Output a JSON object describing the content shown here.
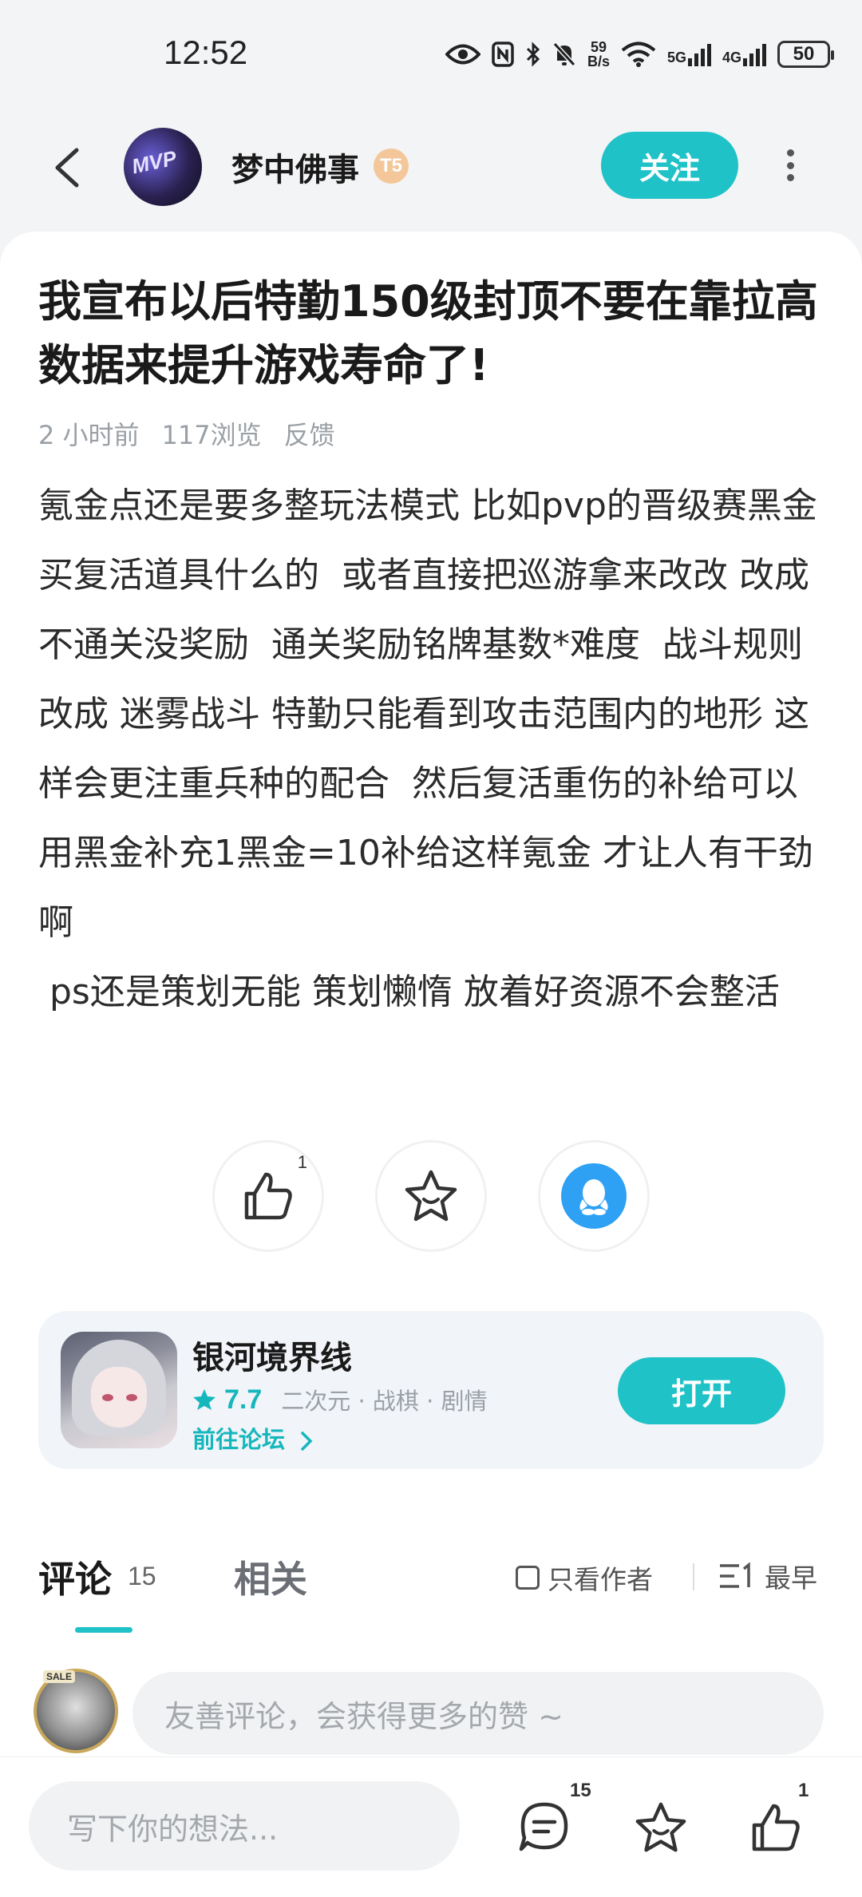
{
  "status_bar": {
    "time": "12:52",
    "net_speed_value": "59",
    "net_speed_unit": "B/s",
    "net_5g": "5G",
    "net_4g": "4G",
    "battery": "50"
  },
  "header": {
    "avatar_text": "MVP",
    "username": "梦中佛事",
    "badge": "T5",
    "follow_label": "关注"
  },
  "post": {
    "title": "我宣布以后特勤150级封顶不要在靠拉高数据来提升游戏寿命了!",
    "time_ago": "2 小时前",
    "views": "117浏览",
    "feedback": "反馈",
    "body": "氪金点还是要多整玩法模式 比如pvp的晋级赛黑金买复活道具什么的  或者直接把巡游拿来改改 改成不通关没奖励  通关奖励铭牌基数*难度  战斗规则改成 迷雾战斗 特勤只能看到攻击范围内的地形 这样会更注重兵种的配合  然后复活重伤的补给可以用黑金补充1黑金=10补给这样氪金 才让人有干劲啊\n ps还是策划无能 策划懒惰 放着好资源不会整活"
  },
  "actions": {
    "like_count": "1"
  },
  "app_card": {
    "name": "银河境界线",
    "rating": "7.7",
    "tags": "二次元 · 战棋 · 剧情",
    "forum_link": "前往论坛",
    "open_label": "打开"
  },
  "tabs": {
    "comment_label": "评论",
    "comment_count": "15",
    "related_label": "相关",
    "only_author": "只看作者",
    "sort_label": "最早"
  },
  "comment_box": {
    "avatar_tag": "SALE",
    "placeholder": "友善评论，会获得更多的赞 ~"
  },
  "bottom_bar": {
    "input_placeholder": "写下你的想法...",
    "comment_count": "15",
    "like_count": "1"
  },
  "colors": {
    "accent": "#1fc2c7",
    "qq_blue": "#2ea1f4"
  }
}
